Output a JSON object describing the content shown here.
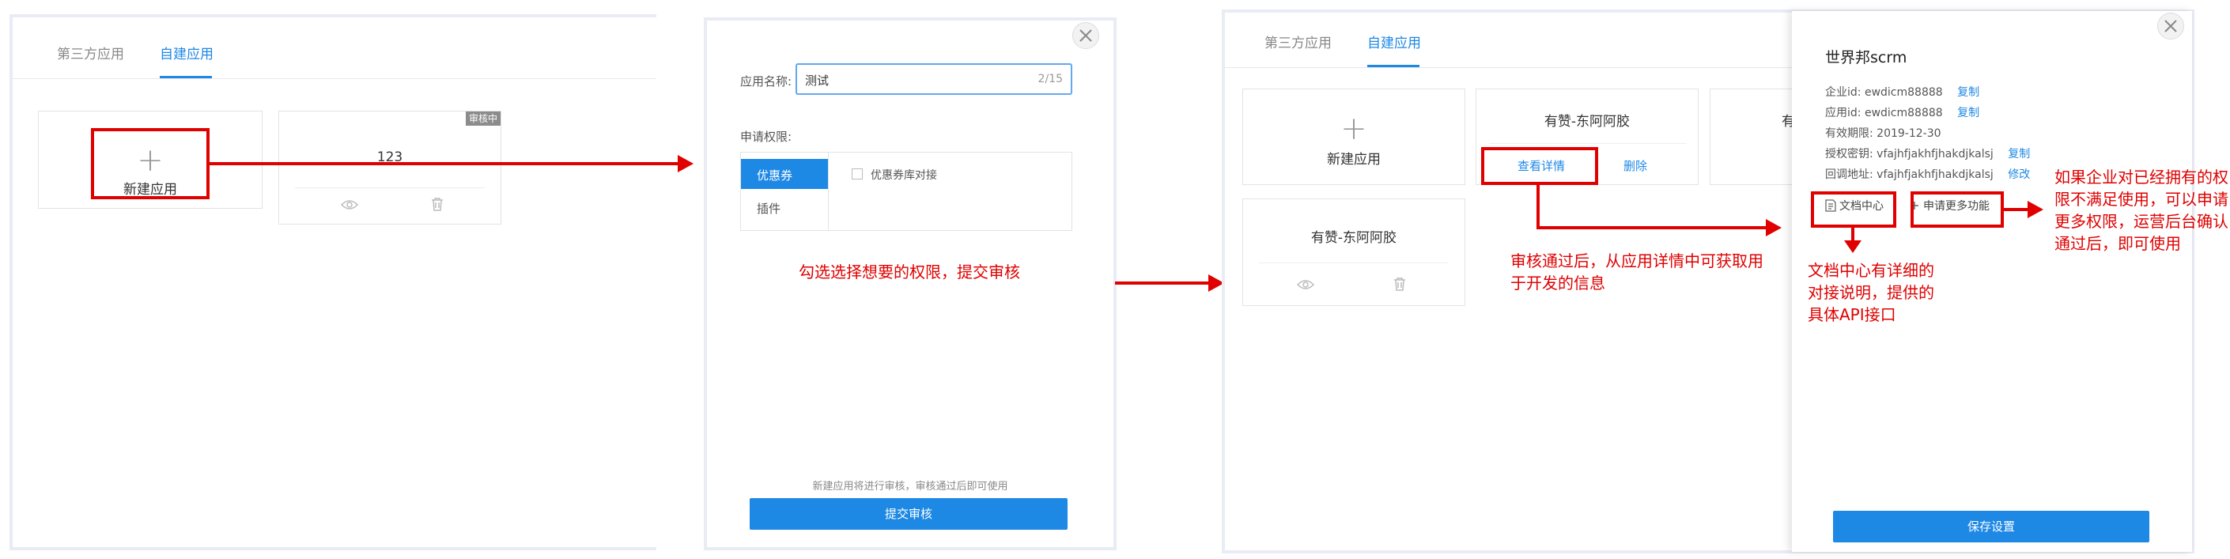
{
  "panel1": {
    "tabs": [
      {
        "label": "第三方应用",
        "active": false
      },
      {
        "label": "自建应用",
        "active": true
      }
    ],
    "new_app_label": "新建应用",
    "app_card": {
      "title": "123",
      "badge": "审核中"
    }
  },
  "panel2": {
    "name_label": "应用名称:",
    "name_value": "测试",
    "name_counter": "2/15",
    "permission_label": "申请权限:",
    "categories": [
      "优惠券",
      "插件"
    ],
    "option_label": "优惠券库对接",
    "hint": "新建应用将进行审核，审核通过后即可使用",
    "submit_label": "提交审核"
  },
  "panel3": {
    "tabs": [
      {
        "label": "第三方应用",
        "active": false
      },
      {
        "label": "自建应用",
        "active": true
      }
    ],
    "new_app_label": "新建应用",
    "card1": {
      "title": "有赞-东阿阿胶",
      "view_label": "查看详情",
      "delete_label": "删除"
    },
    "card2_partial": "有",
    "card3": {
      "title": "有赞-东阿阿胶"
    }
  },
  "drawer": {
    "title": "世界邦scrm",
    "rows": [
      {
        "label": "企业id:",
        "value": "ewdicm88888",
        "link": "复制"
      },
      {
        "label": "应用id:",
        "value": "ewdicm88888",
        "link": "复制"
      },
      {
        "label": "有效期限:",
        "value": "2019-12-30",
        "link": ""
      },
      {
        "label": "授权密钥:",
        "value": "vfajhfjakhfjhakdjkalsj",
        "link": "复制"
      },
      {
        "label": "回调地址:",
        "value": "vfajhfjakhfjhakdjkalsj",
        "link": "修改"
      }
    ],
    "doc_label": "文档中心",
    "more_label": "申请更多功能",
    "save_label": "保存设置"
  },
  "annotations": {
    "a1": "勾选选择想要的权限，提交审核",
    "a2_line1": "审核通过后，从应用详情中可获取用",
    "a2_line2": "于开发的信息",
    "a3_line1": "文档中心有详细的",
    "a3_line2": "对接说明，提供的",
    "a3_line3": "具体API接口",
    "a4_line1": "如果企业对已经拥有的权",
    "a4_line2": "限不满足使用，可以申请",
    "a4_line3": "更多权限，运营后台确认",
    "a4_line4": "通过后，即可使用"
  },
  "colors": {
    "accent": "#1e88e5",
    "annotation_red": "#e00000",
    "frame": "#e9ebf5"
  }
}
